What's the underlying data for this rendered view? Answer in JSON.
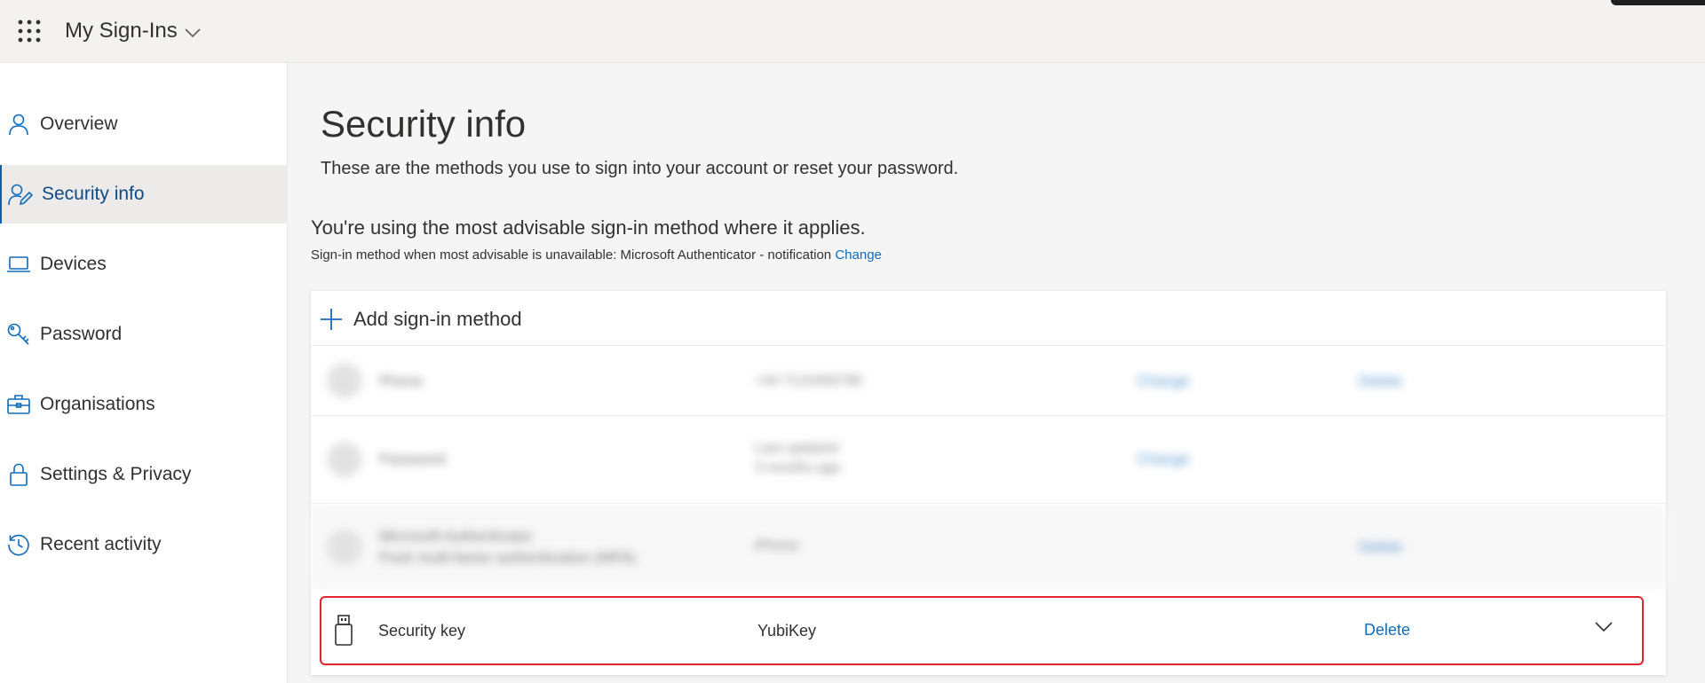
{
  "header": {
    "app_title": "My Sign-Ins",
    "waffle_icon": "waffle-grid-icon",
    "title_chevron_icon": "chevron-down-icon"
  },
  "sidebar": {
    "items": [
      {
        "label": "Overview",
        "icon": "person-icon"
      },
      {
        "label": "Security info",
        "icon": "person-edit-icon",
        "active": true
      },
      {
        "label": "Devices",
        "icon": "laptop-icon"
      },
      {
        "label": "Password",
        "icon": "key-icon"
      },
      {
        "label": "Organisations",
        "icon": "briefcase-icon"
      },
      {
        "label": "Settings & Privacy",
        "icon": "lock-icon"
      },
      {
        "label": "Recent activity",
        "icon": "history-icon"
      }
    ]
  },
  "main": {
    "title": "Security info",
    "subtitle": "These are the methods you use to sign into your account or reset your password.",
    "advisable_text": "You're using the most advisable sign-in method where it applies.",
    "default_method_text": "Sign-in method when most advisable is unavailable: Microsoft Authenticator - notification",
    "default_method_change": "Change",
    "add_method_label": "Add sign-in method",
    "methods": [
      {
        "name": "Phone",
        "detail": "+44 7123456789",
        "action1": "Change",
        "action2": "Delete",
        "blurred": true
      },
      {
        "name": "Password",
        "detail": "Last updated:",
        "detail2": "3 months ago",
        "action1": "Change",
        "action2": "",
        "blurred": true
      },
      {
        "name": "Microsoft Authenticator",
        "name2": "Push multi-factor authentication (MFA)",
        "detail": "iPhone",
        "action1": "",
        "action2": "Delete",
        "blurred": true
      },
      {
        "name": "Security key",
        "detail": "YubiKey",
        "action2": "Delete",
        "icon": "usb-key-icon",
        "expand_icon": "chevron-down-icon",
        "highlighted": true
      }
    ]
  },
  "colors": {
    "accent": "#0f6cbd",
    "active_nav_text": "#0f4a85",
    "highlight_border": "#e0242b"
  }
}
